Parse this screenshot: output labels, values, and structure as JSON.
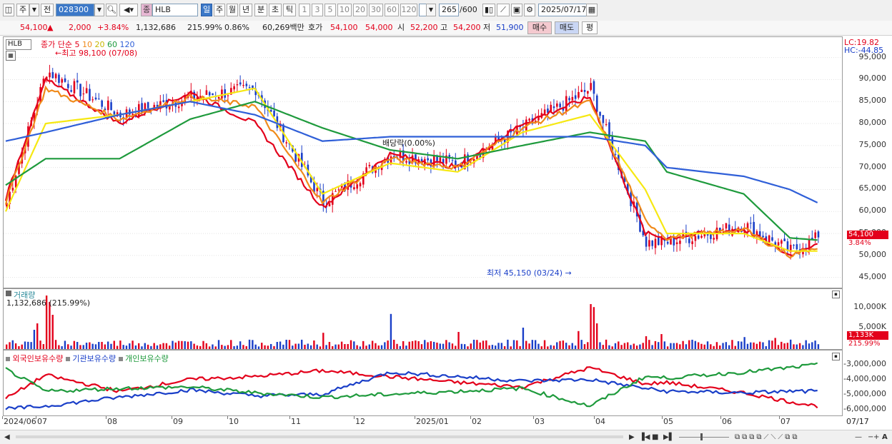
{
  "toolbar": {
    "type_label": "주",
    "jeon_label": "전",
    "code": "028300",
    "name_badge": "종",
    "name": "HLB",
    "periods": [
      "일",
      "주",
      "월",
      "년",
      "분",
      "초",
      "틱"
    ],
    "minutes": [
      "1",
      "3",
      "5",
      "10",
      "20",
      "30",
      "60",
      "120"
    ],
    "count": "265",
    "count_total": "/600",
    "date": "2025/07/17"
  },
  "quote": {
    "price": "54,100",
    "change": "2,000",
    "pct": "+3.84%",
    "volume": "1,132,686",
    "vol_ratio": "215.99%",
    "turnover": "0.86%",
    "amount": "60,269백만",
    "hoga_label": "호가",
    "ask": "54,100",
    "bid": "54,000",
    "open_label": "시",
    "open": "52,200",
    "high_label": "고",
    "high": "54,200",
    "low_label": "저",
    "low": "51,900",
    "buy": "매수",
    "sell": "매도",
    "eval": "평"
  },
  "price_pane": {
    "symbol": "HLB",
    "legend": {
      "title": "종가 단순",
      "ma5": "5",
      "ma10": "10",
      "ma20": "20",
      "ma60": "60",
      "ma120": "120"
    },
    "lc": "LC:19.82",
    "hc": "HC:-44.85",
    "high_note": "최고 98,100 (07/08)",
    "low_note": "최저 45,150 (03/24)",
    "dividend_note": "배당락(0.00%)",
    "last_price": "54,100",
    "last_pct": "3.84%",
    "ticks": [
      "95,000",
      "90,000",
      "85,000",
      "80,000",
      "75,000",
      "70,000",
      "65,000",
      "60,000",
      "55,000",
      "50,000",
      "45,000"
    ]
  },
  "volume_pane": {
    "title": "거래량",
    "value_note": "1,132,686 (215.99%)",
    "ticks": [
      "10,000K",
      "5,000K"
    ],
    "last": "1,133K",
    "last_pct": "215.99%"
  },
  "holding_pane": {
    "legend": [
      "외국인보유수량",
      "기관보유수량",
      "개인보유수량"
    ],
    "ticks": [
      "-3,000,000",
      "-4,000,000",
      "-5,000,000",
      "-6,000,000"
    ]
  },
  "xaxis": [
    "2024/06",
    "07",
    "08",
    "09",
    "10",
    "11",
    "12",
    "2025/01",
    "02",
    "03",
    "04",
    "05",
    "06",
    "07"
  ],
  "xaxis_right": "07/17",
  "colors": {
    "up": "#e3001b",
    "down": "#1a3fc8",
    "ma5": "#e3001b",
    "ma10": "#f08a1a",
    "ma20": "#f6e812",
    "ma60": "#1e9a3c",
    "ma120": "#2f5fd8"
  },
  "chart_data": {
    "type": "line",
    "title": "HLB",
    "price_anchors": {
      "x": [
        "2024/06",
        "07/08",
        "08",
        "09",
        "10",
        "11",
        "12",
        "2025/01",
        "02",
        "03",
        "03/24",
        "04",
        "05",
        "06",
        "07/17"
      ],
      "close": [
        62000,
        92000,
        82000,
        86000,
        88000,
        62000,
        73000,
        71000,
        79000,
        88000,
        53000,
        53000,
        57000,
        51000,
        54100
      ]
    },
    "series": [
      {
        "name": "5",
        "values": [
          63000,
          90000,
          80000,
          87000,
          80000,
          61000,
          73000,
          70000,
          80000,
          86000,
          55000,
          54000,
          56000,
          50000,
          53000
        ]
      },
      {
        "name": "10",
        "values": [
          62000,
          88000,
          81000,
          86000,
          84000,
          62000,
          72000,
          70000,
          79000,
          85000,
          58000,
          54000,
          56000,
          50000,
          52000
        ]
      },
      {
        "name": "20",
        "values": [
          60000,
          80000,
          82000,
          85000,
          88000,
          64000,
          71000,
          69000,
          78000,
          82000,
          65000,
          55000,
          55000,
          51000,
          51000
        ]
      },
      {
        "name": "60",
        "values": [
          66000,
          72000,
          72000,
          81000,
          85000,
          79000,
          74000,
          72000,
          75000,
          78000,
          76000,
          69000,
          64000,
          54000,
          53500
        ]
      },
      {
        "name": "120",
        "values": [
          76000,
          78000,
          82000,
          85000,
          82000,
          76000,
          77000,
          77000,
          77000,
          77000,
          75000,
          70000,
          68000,
          65000,
          62000
        ]
      }
    ],
    "ylim": [
      43000,
      99000
    ],
    "grid": true
  }
}
